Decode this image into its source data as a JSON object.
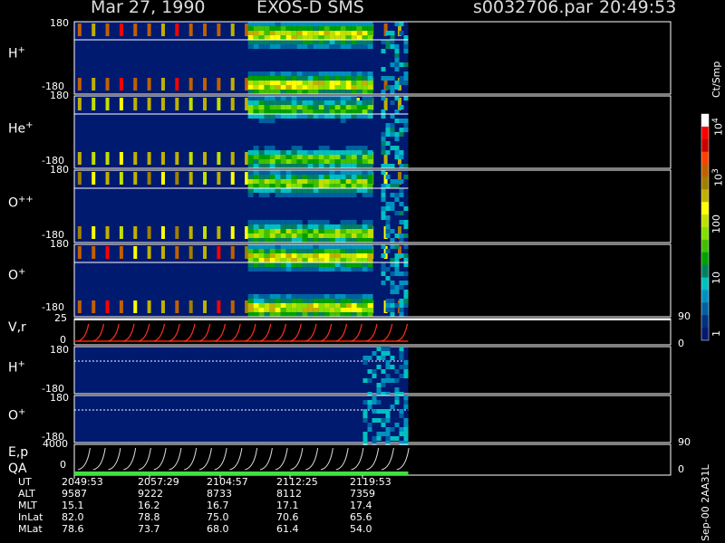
{
  "header": {
    "date": "Mar 27, 1990",
    "mission": "EXOS-D SMS",
    "file": "s0032706.par",
    "time": "20:49:53"
  },
  "panels": [
    {
      "label": "H",
      "sup": "+",
      "top": "180",
      "bottom": "-180"
    },
    {
      "label": "He",
      "sup": "+",
      "top": "180",
      "bottom": "-180"
    },
    {
      "label": "O",
      "sup": "++",
      "top": "180",
      "bottom": "-180"
    },
    {
      "label": "O",
      "sup": "+",
      "top": "180",
      "bottom": "-180"
    }
  ],
  "vr_panel": {
    "label": "V,r",
    "y_top": "25",
    "y_bottom": "0",
    "r_top": "90",
    "r_bottom": "0"
  },
  "lower_panels": [
    {
      "label": "H",
      "sup": "+",
      "top": "180",
      "bottom": "-180"
    },
    {
      "label": "O",
      "sup": "+",
      "top": "180",
      "bottom": "-180"
    }
  ],
  "ep_panel": {
    "label1": "E,p",
    "label2": "QA",
    "y_top": "4000",
    "y_bottom": "0",
    "r_top": "90",
    "r_bottom": "0"
  },
  "colorbar": {
    "unit": "Ct/Smp",
    "labels": [
      "10",
      "10",
      "100",
      "10",
      "1"
    ],
    "sups": [
      "4",
      "3",
      "",
      "",
      ""
    ],
    "colors": [
      "#ffffff",
      "#ff0000",
      "#c80000",
      "#ff4000",
      "#c06000",
      "#a08000",
      "#c0b000",
      "#ffff00",
      "#c0e000",
      "#80e000",
      "#40c000",
      "#00a000",
      "#008060",
      "#00c0c0",
      "#0090c0",
      "#0060a0",
      "#003080",
      "#001a70"
    ]
  },
  "footer": {
    "rows": [
      {
        "name": "UT",
        "values": [
          "2049:53",
          "2057:29",
          "2104:57",
          "2112:25",
          "2119:53"
        ]
      },
      {
        "name": "ALT",
        "values": [
          "9587",
          "9222",
          "8733",
          "8112",
          "7359"
        ]
      },
      {
        "name": "MLT",
        "values": [
          "15.1",
          "16.2",
          "16.7",
          "17.1",
          "17.4"
        ]
      },
      {
        "name": "InLat",
        "values": [
          "82.0",
          "78.8",
          "75.0",
          "70.6",
          "65.6"
        ]
      },
      {
        "name": "MLat",
        "values": [
          "78.6",
          "73.7",
          "68.0",
          "61.4",
          "54.0"
        ]
      }
    ],
    "side_note": "Sep-00 2AA31L"
  },
  "chart_data": {
    "type": "heatmap",
    "title": "Mar 27, 1990   EXOS-D SMS",
    "x_ticks": [
      "2049:53",
      "2057:29",
      "2104:57",
      "2112:25",
      "2119:53"
    ],
    "y_range_pitch": [
      -180,
      180
    ],
    "data_extent_fraction": 0.56,
    "colorbar_range": [
      1,
      10000
    ],
    "colorbar_scale": "log",
    "vr_range": [
      0,
      25
    ],
    "ep_range": [
      0,
      4000
    ],
    "panels": [
      "H+",
      "He+",
      "O++",
      "O+",
      "V,r",
      "H+",
      "O+",
      "E,p QA"
    ]
  }
}
